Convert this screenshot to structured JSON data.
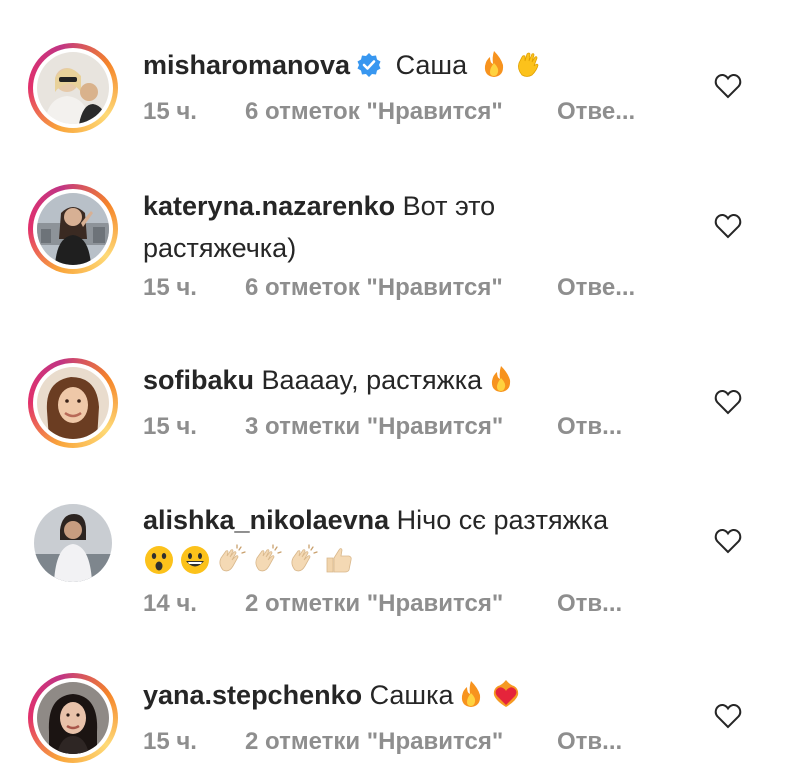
{
  "comments": [
    {
      "username": "misharomanova",
      "verified": true,
      "text": "Саша",
      "emojis": [
        "fire-emoji",
        "waving-hand-emoji"
      ],
      "time": "15 ч.",
      "likes": "6 отметок \"Нравится\"",
      "reply": "Отве..."
    },
    {
      "username": "kateryna.nazarenko",
      "verified": false,
      "text": "Вот это",
      "text_line2": "растяжечка)",
      "emojis": [],
      "time": "15 ч.",
      "likes": "6 отметок \"Нравится\"",
      "reply": "Отве..."
    },
    {
      "username": "sofibaku",
      "verified": false,
      "text": "Вааааy, растяжка",
      "emojis": [
        "fire-emoji"
      ],
      "time": "15 ч.",
      "likes": "3 отметки \"Нравится\"",
      "reply": "Отв..."
    },
    {
      "username": "alishka_nikolaevna",
      "verified": false,
      "text": "Нічо сє разтяжка",
      "emojis": [
        "astonished-face-emoji",
        "grinning-face-emoji",
        "clapping-hands-emoji",
        "clapping-hands-emoji",
        "clapping-hands-emoji",
        "thumbs-up-emoji"
      ],
      "time": "14 ч.",
      "likes": "2 отметки \"Нравится\"",
      "reply": "Отв..."
    },
    {
      "username": "yana.stepchenko",
      "verified": false,
      "text": "Сашка",
      "emojis": [
        "fire-emoji",
        "heart-on-fire-emoji"
      ],
      "time": "15 ч.",
      "likes": "2 отметки \"Нравится\"",
      "reply": "Отв..."
    }
  ],
  "icons": {
    "verified": "verified-badge-icon",
    "like": "heart-outline-icon"
  },
  "colors": {
    "text": "#262626",
    "meta": "#8e8e8e",
    "verified": "#3897f0",
    "background": "#ffffff"
  }
}
